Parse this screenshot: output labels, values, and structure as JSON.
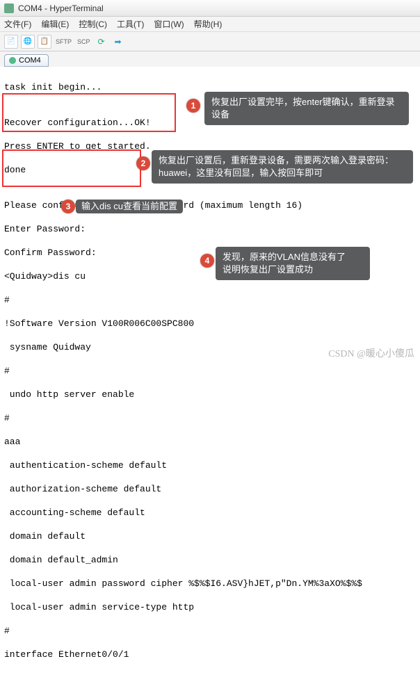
{
  "window": {
    "title": "COM4 - HyperTerminal"
  },
  "menu": {
    "file": "文件(F)",
    "edit": "编辑(E)",
    "control": "控制(C)",
    "tools": "工具(T)",
    "window": "窗口(W)",
    "help": "帮助(H)"
  },
  "toolbar": {
    "sftp": "SFTP",
    "scp": "SCP"
  },
  "tab": {
    "label": "COM4"
  },
  "term": {
    "l1": "task init begin...",
    "l2": "",
    "l3": "Recover configuration...OK!",
    "l4": "Press ENTER to get started.",
    "l5": "done",
    "l6": "",
    "l7": "Please configure the login password (maximum length 16)",
    "l8": "Enter Password:",
    "l9": "Confirm Password:",
    "l10": "<Quidway>dis cu",
    "l11": "#",
    "l12": "!Software Version V100R006C00SPC800",
    "l13": " sysname Quidway",
    "l14": "#",
    "l15": " undo http server enable",
    "l16": "#",
    "l17": "aaa",
    "l18": " authentication-scheme default",
    "l19": " authorization-scheme default",
    "l20": " accounting-scheme default",
    "l21": " domain default",
    "l22": " domain default_admin",
    "l23": " local-user admin password cipher %$%$I6.ASV}hJET,p\"Dn.YM%3aXO%$%$",
    "l24": " local-user admin service-type http",
    "l25": "#",
    "l26": "interface Ethernet0/0/1"
  },
  "callouts": {
    "c1": "恢复出厂设置完毕，按enter键确认，重新登录设备",
    "c2": "恢复出厂设置后，重新登录设备，需要两次输入登录密码：huawei，这里没有回显，输入按回车即可",
    "c3": "输入dis cu查看当前配置",
    "c4": "发现，原来的VLAN信息没有了\n说明恢复出厂设置成功",
    "n1": "1",
    "n2": "2",
    "n3": "3",
    "n4": "4"
  },
  "watermark": "CSDN @暖心小傻瓜"
}
